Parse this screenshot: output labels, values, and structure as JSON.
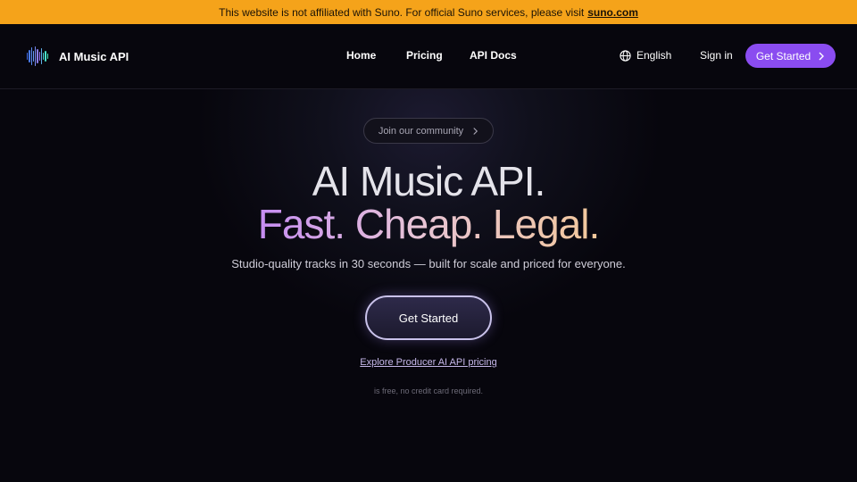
{
  "banner": {
    "text": "This website is not affiliated with Suno. For official Suno services, please visit",
    "link": "suno.com"
  },
  "nav": {
    "brand": "AI Music API",
    "links": [
      "Home",
      "Pricing",
      "API Docs"
    ],
    "language": "English",
    "signin": "Sign in",
    "cta": "Get Started"
  },
  "hero": {
    "pill": "Join our community",
    "title_line1": "AI Music API.",
    "title_line2": "Fast. Cheap. Legal.",
    "subtitle": "Studio-quality tracks in 30 seconds — built for scale and priced for everyone.",
    "cta": "Get Started",
    "explore_link": "Explore Producer AI API pricing",
    "note": "is free, no credit card required."
  },
  "colors": {
    "banner": "#f5a31a",
    "accent": "#8a4cf0",
    "background": "#07060d"
  },
  "icons": [
    "waveform-logo-icon",
    "globe-icon",
    "chevron-right-icon"
  ]
}
